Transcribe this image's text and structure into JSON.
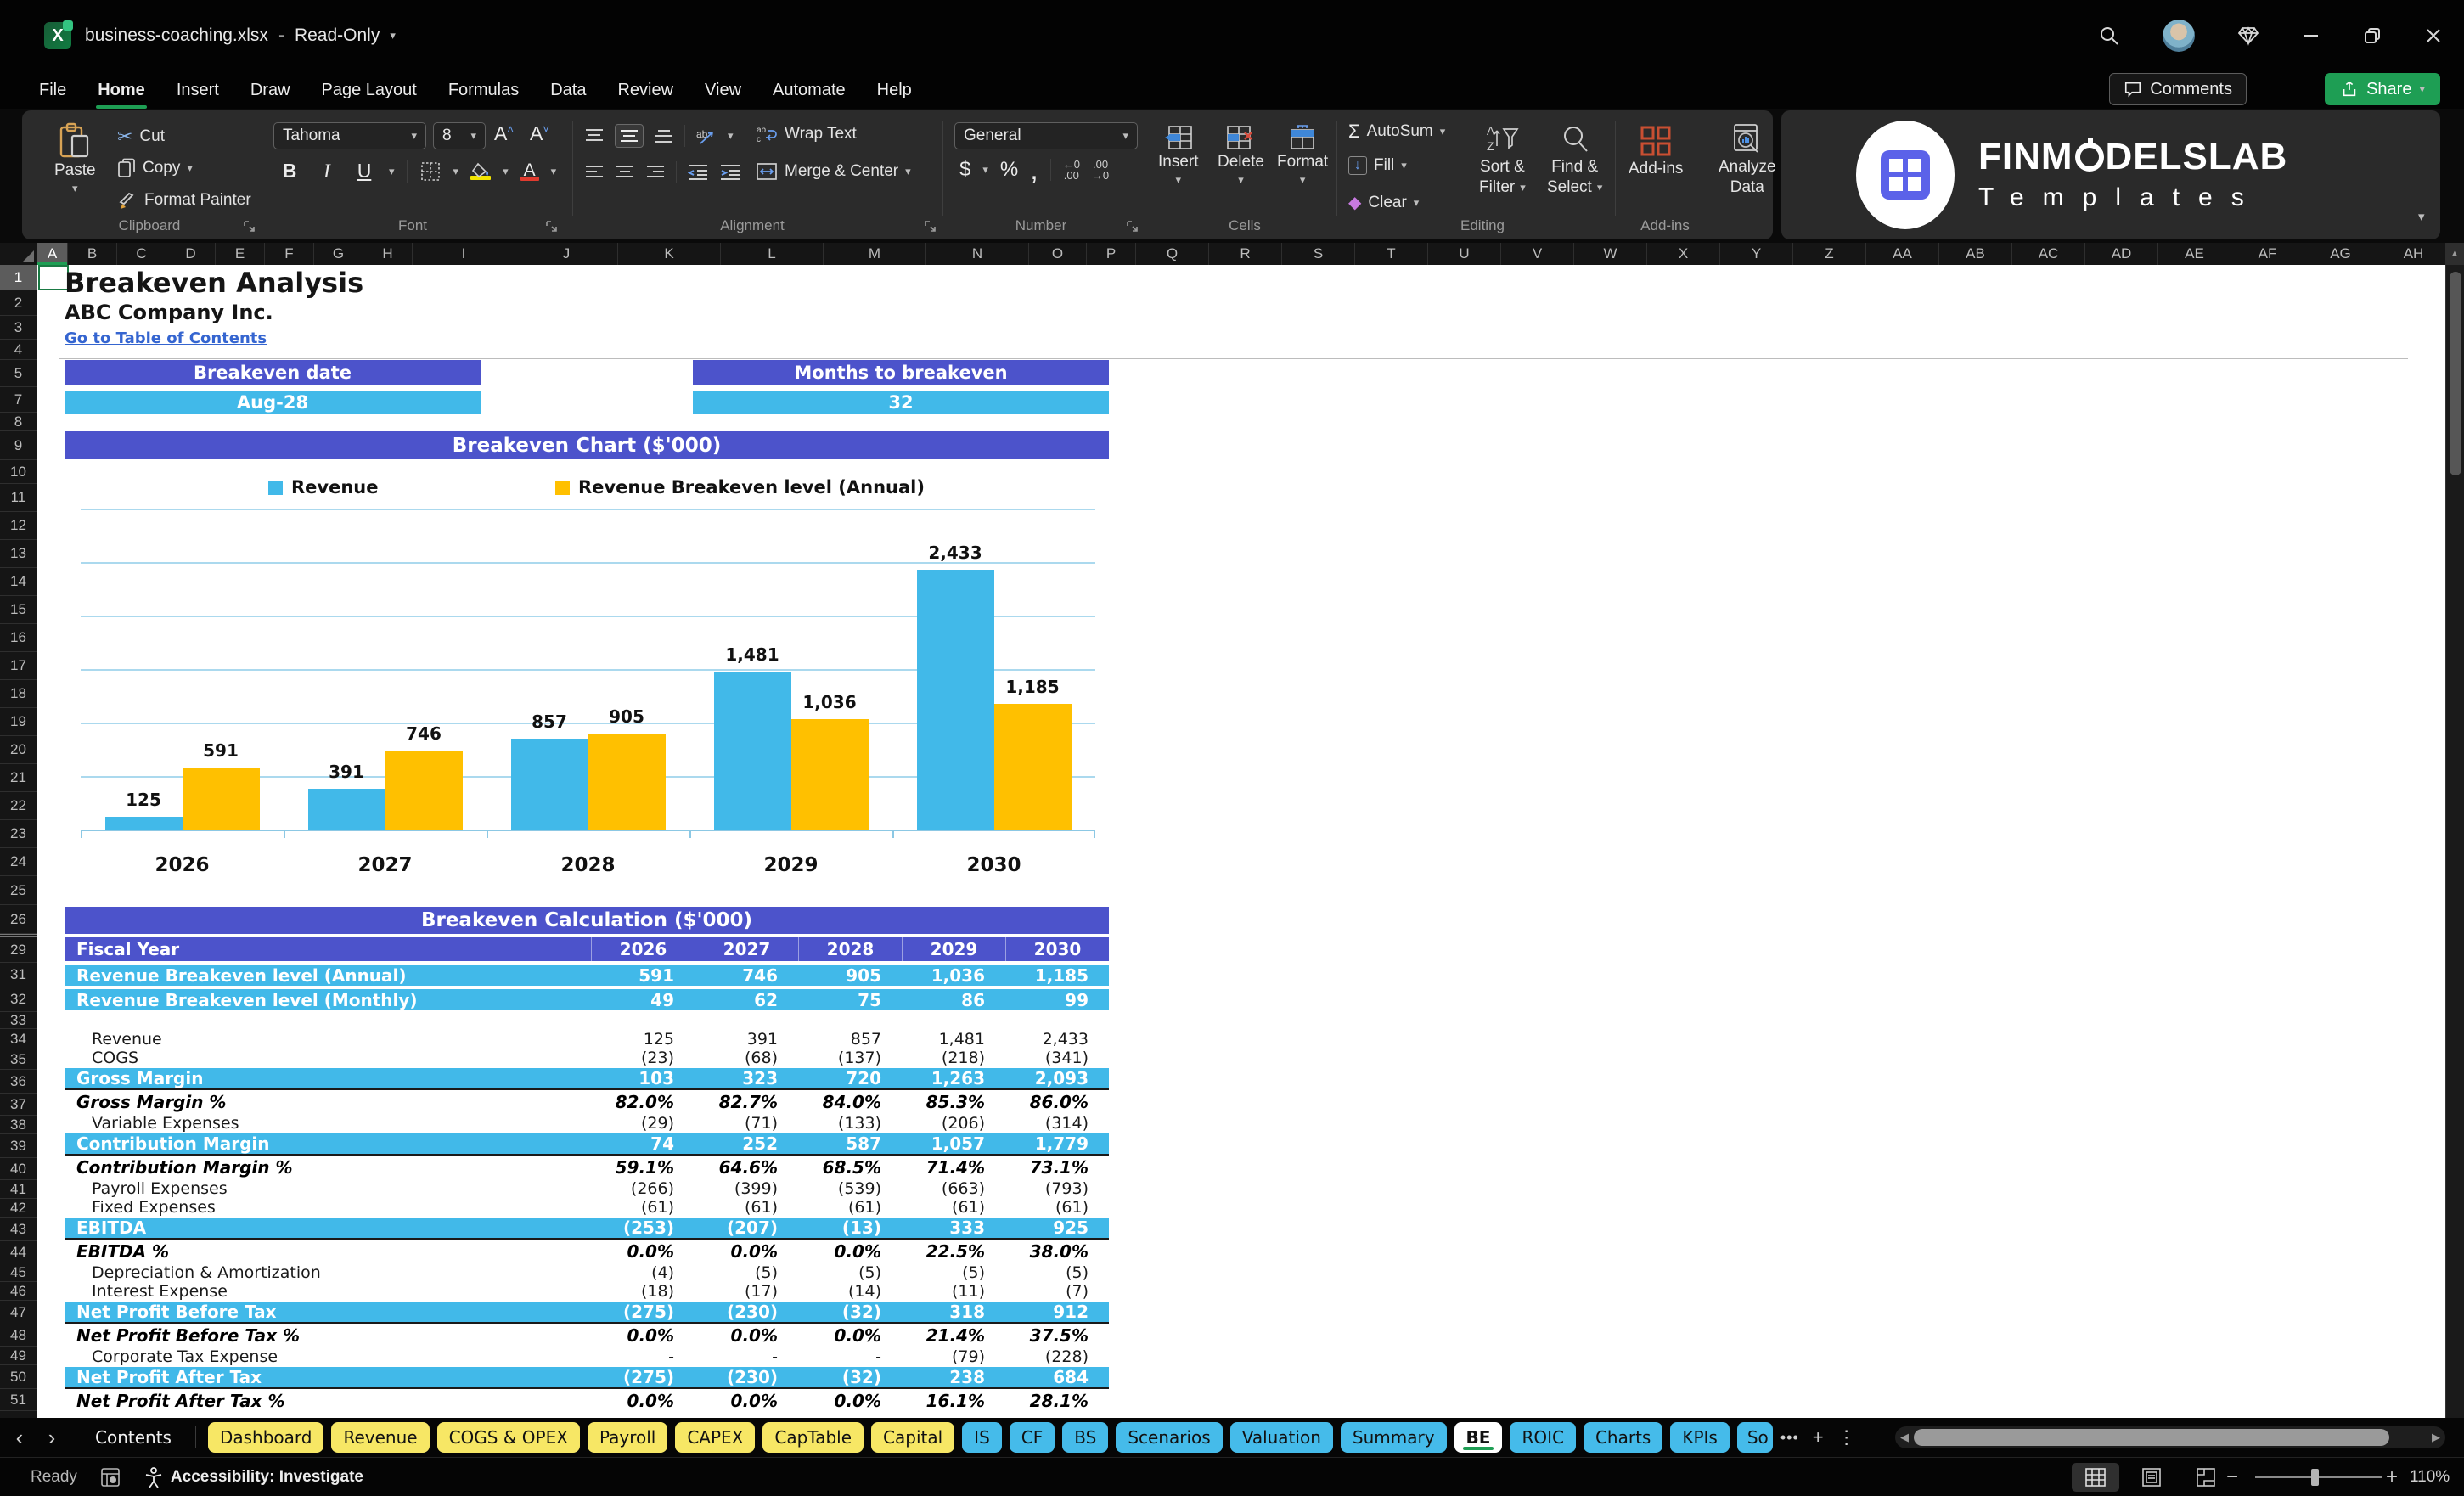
{
  "window": {
    "title": "business-coaching.xlsx",
    "separator": "-",
    "mode": "Read-Only"
  },
  "menu": {
    "tabs": [
      "File",
      "Home",
      "Insert",
      "Draw",
      "Page Layout",
      "Formulas",
      "Data",
      "Review",
      "View",
      "Automate",
      "Help"
    ],
    "active_tab": "Home",
    "comments_label": "Comments",
    "share_label": "Share"
  },
  "ribbon": {
    "clipboard": {
      "group": "Clipboard",
      "paste": "Paste",
      "cut": "Cut",
      "copy": "Copy",
      "format_painter": "Format Painter"
    },
    "font": {
      "group": "Font",
      "font_name": "Tahoma",
      "font_size": "8"
    },
    "alignment": {
      "group": "Alignment",
      "wrap_text": "Wrap Text",
      "merge_center": "Merge & Center"
    },
    "number": {
      "group": "Number",
      "format": "General"
    },
    "cells": {
      "group": "Cells",
      "insert": "Insert",
      "delete": "Delete",
      "format": "Format"
    },
    "editing": {
      "group": "Editing",
      "autosum": "AutoSum",
      "fill": "Fill",
      "clear": "Clear",
      "sort1": "Sort &",
      "sort2": "Filter",
      "find1": "Find &",
      "find2": "Select"
    },
    "addins": {
      "group": "Add-ins",
      "addins": "Add-ins",
      "analyze1": "Analyze",
      "analyze2": "Data"
    }
  },
  "logo": {
    "brand_pre": "FINM",
    "brand_post": "DELSLAB",
    "subtitle": "Templates"
  },
  "columns": [
    "A",
    "B",
    "C",
    "D",
    "E",
    "F",
    "G",
    "H",
    "I",
    "J",
    "K",
    "L",
    "M",
    "N",
    "O",
    "P",
    "Q",
    "R",
    "S",
    "T",
    "U",
    "V",
    "W",
    "X",
    "Y",
    "Z",
    "AA",
    "AB",
    "AC",
    "AD",
    "AE",
    "AF",
    "AG",
    "AH"
  ],
  "rows": [
    "1",
    "2",
    "3",
    "4",
    "5",
    "7",
    "8",
    "9",
    "10",
    "11",
    "12",
    "13",
    "14",
    "15",
    "16",
    "17",
    "18",
    "19",
    "20",
    "21",
    "22",
    "23",
    "24",
    "25",
    "26",
    "29",
    "31",
    "32",
    "33",
    "34",
    "35",
    "36",
    "37",
    "38",
    "39",
    "40",
    "41",
    "42",
    "43",
    "44",
    "45",
    "46",
    "47",
    "48",
    "49",
    "50",
    "51"
  ],
  "sheet": {
    "title": "Breakeven Analysis",
    "company": "ABC Company Inc.",
    "link": "Go to Table of Contents",
    "kpi": [
      {
        "label": "Breakeven date",
        "value": "Aug-28"
      },
      {
        "label": "Months to breakeven",
        "value": "32"
      }
    ],
    "calc_banner": "Breakeven Calculation ($'000)"
  },
  "chart_data": {
    "type": "bar",
    "title": "Breakeven Chart ($'000)",
    "categories": [
      "2026",
      "2027",
      "2028",
      "2029",
      "2030"
    ],
    "series": [
      {
        "name": "Revenue",
        "color": "#41B9E9",
        "values": [
          125,
          391,
          857,
          1481,
          2433
        ],
        "labels": [
          "125",
          "391",
          "857",
          "1,481",
          "2,433"
        ]
      },
      {
        "name": "Revenue Breakeven level (Annual)",
        "color": "#FFC000",
        "values": [
          591,
          746,
          905,
          1036,
          1185
        ],
        "labels": [
          "591",
          "746",
          "905",
          "1,036",
          "1,185"
        ]
      }
    ],
    "xlabel": "",
    "ylabel": "",
    "ylim": [
      0,
      3000
    ],
    "gridline_step": 500,
    "grid": true,
    "legend_position": "top",
    "y_axis_labels_visible": false
  },
  "table": {
    "header_label": "Fiscal Year",
    "years": [
      "2026",
      "2027",
      "2028",
      "2029",
      "2030"
    ],
    "rows": [
      {
        "label": "Revenue Breakeven level (Annual)",
        "style": "accent",
        "values": [
          "591",
          "746",
          "905",
          "1,036",
          "1,185"
        ]
      },
      {
        "label": "Revenue Breakeven level (Monthly)",
        "style": "accent",
        "gap_after": true,
        "values": [
          "49",
          "62",
          "75",
          "86",
          "99"
        ]
      },
      {
        "label": "Revenue",
        "style": "plain",
        "values": [
          "125",
          "391",
          "857",
          "1,481",
          "2,433"
        ]
      },
      {
        "label": "COGS",
        "style": "plain",
        "values": [
          "(23)",
          "(68)",
          "(137)",
          "(218)",
          "(341)"
        ]
      },
      {
        "label": "Gross Margin",
        "style": "total",
        "values": [
          "103",
          "323",
          "720",
          "1,263",
          "2,093"
        ]
      },
      {
        "label": "Gross Margin %",
        "style": "percent",
        "values": [
          "82.0%",
          "82.7%",
          "84.0%",
          "85.3%",
          "86.0%"
        ]
      },
      {
        "label": "Variable Expenses",
        "style": "plain",
        "values": [
          "(29)",
          "(71)",
          "(133)",
          "(206)",
          "(314)"
        ]
      },
      {
        "label": "Contribution Margin",
        "style": "total",
        "values": [
          "74",
          "252",
          "587",
          "1,057",
          "1,779"
        ]
      },
      {
        "label": "Contribution Margin %",
        "style": "percent",
        "values": [
          "59.1%",
          "64.6%",
          "68.5%",
          "71.4%",
          "73.1%"
        ]
      },
      {
        "label": "Payroll Expenses",
        "style": "plain",
        "values": [
          "(266)",
          "(399)",
          "(539)",
          "(663)",
          "(793)"
        ]
      },
      {
        "label": "Fixed Expenses",
        "style": "plain",
        "values": [
          "(61)",
          "(61)",
          "(61)",
          "(61)",
          "(61)"
        ]
      },
      {
        "label": "EBITDA",
        "style": "total",
        "values": [
          "(253)",
          "(207)",
          "(13)",
          "333",
          "925"
        ]
      },
      {
        "label": "EBITDA %",
        "style": "percent",
        "values": [
          "0.0%",
          "0.0%",
          "0.0%",
          "22.5%",
          "38.0%"
        ]
      },
      {
        "label": "Depreciation & Amortization",
        "style": "plain",
        "values": [
          "(4)",
          "(5)",
          "(5)",
          "(5)",
          "(5)"
        ]
      },
      {
        "label": "Interest Expense",
        "style": "plain",
        "values": [
          "(18)",
          "(17)",
          "(14)",
          "(11)",
          "(7)"
        ]
      },
      {
        "label": "Net Profit Before Tax",
        "style": "total",
        "values": [
          "(275)",
          "(230)",
          "(32)",
          "318",
          "912"
        ]
      },
      {
        "label": "Net Profit Before Tax %",
        "style": "percent",
        "values": [
          "0.0%",
          "0.0%",
          "0.0%",
          "21.4%",
          "37.5%"
        ]
      },
      {
        "label": "Corporate Tax Expense",
        "style": "plain",
        "values": [
          "-",
          "-",
          "-",
          "(79)",
          "(228)"
        ]
      },
      {
        "label": "Net Profit After Tax",
        "style": "total",
        "values": [
          "(275)",
          "(230)",
          "(32)",
          "238",
          "684"
        ]
      },
      {
        "label": "Net Profit After Tax %",
        "style": "percent",
        "values": [
          "0.0%",
          "0.0%",
          "0.0%",
          "16.1%",
          "28.1%"
        ]
      }
    ]
  },
  "sheet_tabs": {
    "tabs": [
      {
        "label": "Contents",
        "style": "plain"
      },
      {
        "label": "Dashboard",
        "style": "yellow"
      },
      {
        "label": "Revenue",
        "style": "yellow"
      },
      {
        "label": "COGS & OPEX",
        "style": "yellow"
      },
      {
        "label": "Payroll",
        "style": "yellow"
      },
      {
        "label": "CAPEX",
        "style": "yellow"
      },
      {
        "label": "CapTable",
        "style": "yellow"
      },
      {
        "label": "Capital",
        "style": "yellow"
      },
      {
        "label": "IS",
        "style": "blue"
      },
      {
        "label": "CF",
        "style": "blue"
      },
      {
        "label": "BS",
        "style": "blue"
      },
      {
        "label": "Scenarios",
        "style": "blue"
      },
      {
        "label": "Valuation",
        "style": "blue"
      },
      {
        "label": "Summary",
        "style": "blue"
      },
      {
        "label": "BE",
        "style": "active"
      },
      {
        "label": "ROIC",
        "style": "blue"
      },
      {
        "label": "Charts",
        "style": "blue"
      },
      {
        "label": "KPIs",
        "style": "blue"
      },
      {
        "label": "So",
        "style": "clipped"
      }
    ],
    "more": "•••",
    "add": "+",
    "menu": "⋮"
  },
  "status": {
    "ready": "Ready",
    "accessibility": "Accessibility: Investigate",
    "zoom": "110%"
  }
}
